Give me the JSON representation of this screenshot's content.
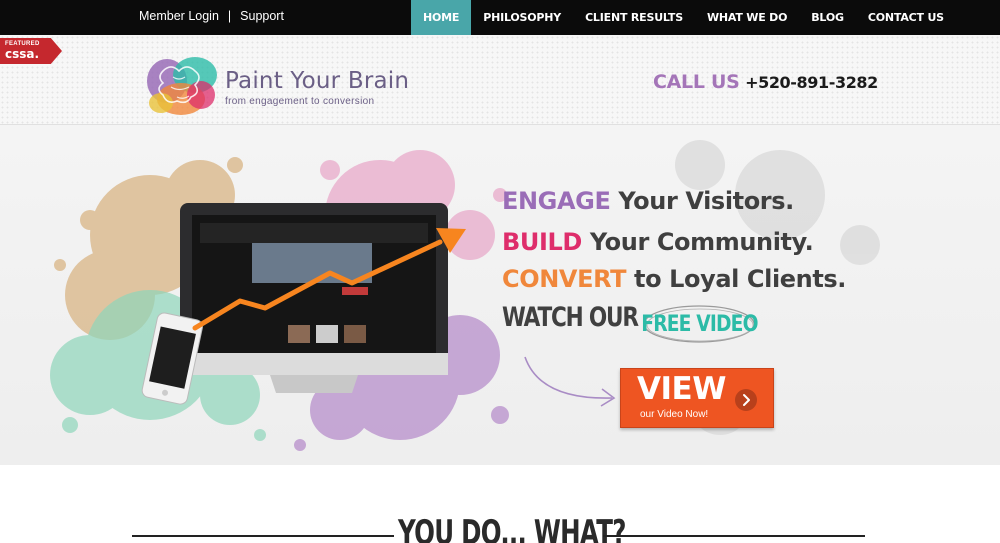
{
  "top_links": {
    "member_login": "Member Login",
    "separator": "|",
    "support": "Support"
  },
  "nav": {
    "items": [
      {
        "label": "HOME",
        "active": true
      },
      {
        "label": "PHILOSOPHY",
        "active": false
      },
      {
        "label": "CLIENT RESULTS",
        "active": false
      },
      {
        "label": "WHAT WE DO",
        "active": false
      },
      {
        "label": "BLOG",
        "active": false
      },
      {
        "label": "CONTACT US",
        "active": false
      }
    ]
  },
  "ribbon": {
    "small": "FEATURED",
    "big": "cssa."
  },
  "brand": {
    "name": "Paint Your Brain",
    "tagline": "from engagement to conversion"
  },
  "contact": {
    "label": "CALL US",
    "phone": "+520-891-3282"
  },
  "hero": {
    "line1": {
      "highlight": "ENGAGE",
      "rest": " Your Visitors."
    },
    "line2": {
      "highlight": "BUILD",
      "rest": " Your Community."
    },
    "line3": {
      "highlight": "CONVERT",
      "rest": " to Loyal Clients."
    },
    "watch_our": "WATCH OUR",
    "free_video": "FREE VIDEO",
    "view_button": {
      "title": "VIEW",
      "subtitle": "our Video Now!"
    }
  },
  "section": {
    "heading": "YOU DO... WHAT?"
  },
  "colors": {
    "nav_active": "#49a6a9",
    "engage": "#9a6db7",
    "build": "#de2d6b",
    "convert": "#f0873b",
    "free_video": "#2cbba7",
    "view_button": "#ee5522",
    "call_us": "#a475b8"
  }
}
